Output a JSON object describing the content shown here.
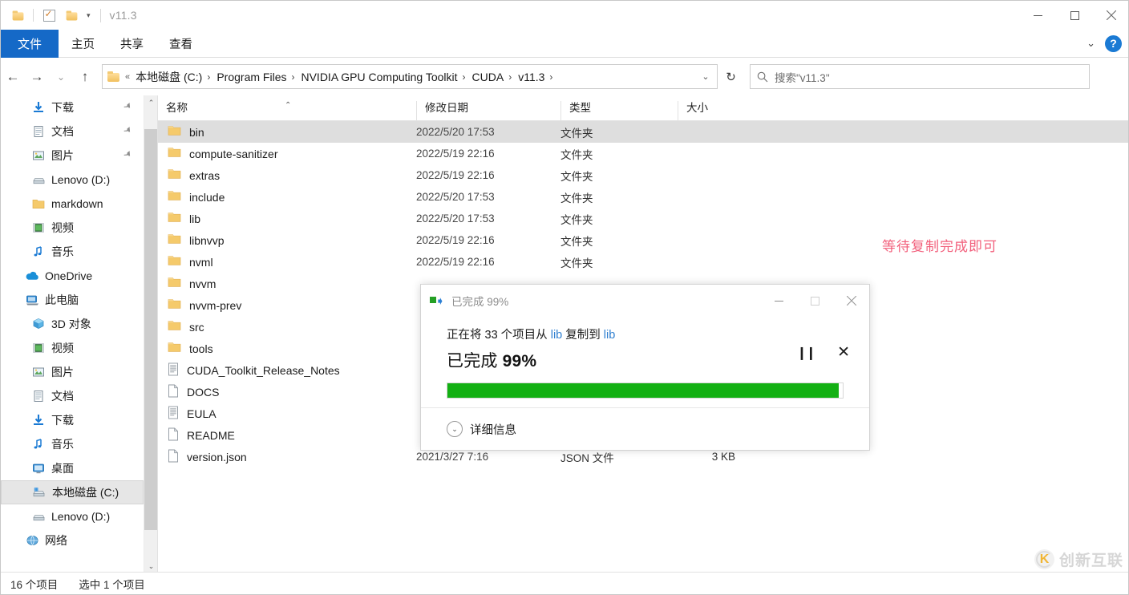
{
  "window": {
    "title": "v11.3",
    "quick_access": [
      {
        "name": "folder-icon",
        "label": ""
      },
      {
        "name": "properties-icon",
        "label": ""
      },
      {
        "name": "new-folder-icon",
        "label": ""
      },
      {
        "name": "customize-caret-icon",
        "label": "▾"
      }
    ],
    "controls": {
      "minimize": "minimize-icon",
      "maximize": "maximize-icon",
      "close": "close-icon"
    }
  },
  "ribbon": {
    "tabs": [
      {
        "label": "文件",
        "active": true
      },
      {
        "label": "主页",
        "active": false
      },
      {
        "label": "共享",
        "active": false
      },
      {
        "label": "查看",
        "active": false
      }
    ],
    "collapse_icon": "chevron-down-icon",
    "help_icon": "?"
  },
  "navigation": {
    "back_icon": "←",
    "forward_icon": "→",
    "recent_icon": "⌄",
    "up_icon": "↑",
    "refresh_icon": "↻",
    "address_prefix": "«",
    "address_dropdown_icon": "⌄",
    "breadcrumbs": [
      "本地磁盘 (C:)",
      "Program Files",
      "NVIDIA GPU Computing Toolkit",
      "CUDA",
      "v11.3"
    ]
  },
  "search": {
    "icon": "search-icon",
    "placeholder": "搜索\"v11.3\""
  },
  "sidebar": {
    "scroll_up_icon": "⌃",
    "scroll_down_icon": "⌄",
    "items": [
      {
        "label": "下载",
        "icon": "download-icon",
        "pinned": true,
        "indent": 1,
        "selected": false
      },
      {
        "label": "文档",
        "icon": "documents-icon",
        "pinned": true,
        "indent": 1,
        "selected": false
      },
      {
        "label": "图片",
        "icon": "pictures-icon",
        "pinned": true,
        "indent": 1,
        "selected": false
      },
      {
        "label": "Lenovo (D:)",
        "icon": "drive-icon",
        "pinned": false,
        "indent": 1,
        "selected": false
      },
      {
        "label": "markdown",
        "icon": "folder-icon",
        "pinned": false,
        "indent": 1,
        "selected": false
      },
      {
        "label": "视频",
        "icon": "videos-icon",
        "pinned": false,
        "indent": 1,
        "selected": false
      },
      {
        "label": "音乐",
        "icon": "music-icon",
        "pinned": false,
        "indent": 1,
        "selected": false
      },
      {
        "label": "OneDrive",
        "icon": "onedrive-icon",
        "pinned": false,
        "indent": 0,
        "selected": false
      },
      {
        "label": "此电脑",
        "icon": "this-pc-icon",
        "pinned": false,
        "indent": 0,
        "selected": false
      },
      {
        "label": "3D 对象",
        "icon": "3d-objects-icon",
        "pinned": false,
        "indent": 1,
        "selected": false
      },
      {
        "label": "视频",
        "icon": "videos-icon",
        "pinned": false,
        "indent": 1,
        "selected": false
      },
      {
        "label": "图片",
        "icon": "pictures-icon",
        "pinned": false,
        "indent": 1,
        "selected": false
      },
      {
        "label": "文档",
        "icon": "documents-icon",
        "pinned": false,
        "indent": 1,
        "selected": false
      },
      {
        "label": "下载",
        "icon": "download-icon",
        "pinned": false,
        "indent": 1,
        "selected": false
      },
      {
        "label": "音乐",
        "icon": "music-icon",
        "pinned": false,
        "indent": 1,
        "selected": false
      },
      {
        "label": "桌面",
        "icon": "desktop-icon",
        "pinned": false,
        "indent": 1,
        "selected": false
      },
      {
        "label": "本地磁盘 (C:)",
        "icon": "local-disk-icon",
        "pinned": false,
        "indent": 1,
        "selected": true
      },
      {
        "label": "Lenovo (D:)",
        "icon": "drive-icon",
        "pinned": false,
        "indent": 1,
        "selected": false
      },
      {
        "label": "网络",
        "icon": "network-icon",
        "pinned": false,
        "indent": 0,
        "selected": false
      }
    ]
  },
  "filelist": {
    "columns": [
      {
        "label": "名称",
        "key": "name",
        "sorted": true,
        "sort_dir": "asc"
      },
      {
        "label": "修改日期",
        "key": "date"
      },
      {
        "label": "类型",
        "key": "type"
      },
      {
        "label": "大小",
        "key": "size"
      }
    ],
    "rows": [
      {
        "name": "bin",
        "date": "2022/5/20 17:53",
        "type": "文件夹",
        "size": "",
        "kind": "folder",
        "selected": true
      },
      {
        "name": "compute-sanitizer",
        "date": "2022/5/19 22:16",
        "type": "文件夹",
        "size": "",
        "kind": "folder",
        "selected": false
      },
      {
        "name": "extras",
        "date": "2022/5/19 22:16",
        "type": "文件夹",
        "size": "",
        "kind": "folder",
        "selected": false
      },
      {
        "name": "include",
        "date": "2022/5/20 17:53",
        "type": "文件夹",
        "size": "",
        "kind": "folder",
        "selected": false
      },
      {
        "name": "lib",
        "date": "2022/5/20 17:53",
        "type": "文件夹",
        "size": "",
        "kind": "folder",
        "selected": false
      },
      {
        "name": "libnvvp",
        "date": "2022/5/19 22:16",
        "type": "文件夹",
        "size": "",
        "kind": "folder",
        "selected": false
      },
      {
        "name": "nvml",
        "date": "2022/5/19 22:16",
        "type": "文件夹",
        "size": "",
        "kind": "folder",
        "selected": false
      },
      {
        "name": "nvvm",
        "date": "",
        "type": "",
        "size": "",
        "kind": "folder",
        "selected": false
      },
      {
        "name": "nvvm-prev",
        "date": "",
        "type": "",
        "size": "",
        "kind": "folder",
        "selected": false
      },
      {
        "name": "src",
        "date": "",
        "type": "",
        "size": "",
        "kind": "folder",
        "selected": false
      },
      {
        "name": "tools",
        "date": "",
        "type": "",
        "size": "",
        "kind": "folder",
        "selected": false
      },
      {
        "name": "CUDA_Toolkit_Release_Notes",
        "date": "",
        "type": "",
        "size": "",
        "kind": "file-lined",
        "selected": false
      },
      {
        "name": "DOCS",
        "date": "",
        "type": "",
        "size": "",
        "kind": "file",
        "selected": false
      },
      {
        "name": "EULA",
        "date": "",
        "type": "",
        "size": "",
        "kind": "file-lined",
        "selected": false
      },
      {
        "name": "README",
        "date": "",
        "type": "",
        "size": "",
        "kind": "file",
        "selected": false
      },
      {
        "name": "version.json",
        "date": "2021/3/27 7:16",
        "type": "JSON 文件",
        "size": "3 KB",
        "kind": "file",
        "selected": false
      }
    ]
  },
  "annotation": {
    "text": "等待复制完成即可",
    "color": "#f2607c"
  },
  "copy_dialog": {
    "title": "已完成 99%",
    "title_icon": "copy-icon",
    "line1_prefix": "正在将 33 个项目从 ",
    "line1_source": "lib",
    "line1_mid": " 复制到 ",
    "line1_dest": "lib",
    "status": "已完成 99%",
    "status_label": "已完成 ",
    "status_percent": "99%",
    "progress": 99,
    "progress_color": "#13b013",
    "pause_icon": "pause-icon",
    "cancel_icon": "cancel-icon",
    "details_label": "详细信息",
    "details_chevron": "⌄",
    "controls": {
      "minimize": "minimize-icon",
      "maximize": "maximize-icon",
      "close": "close-icon"
    }
  },
  "statusbar": {
    "item_count": "16 个项目",
    "selection": "选中 1 个项目"
  },
  "watermark": {
    "text": "创新互联"
  }
}
